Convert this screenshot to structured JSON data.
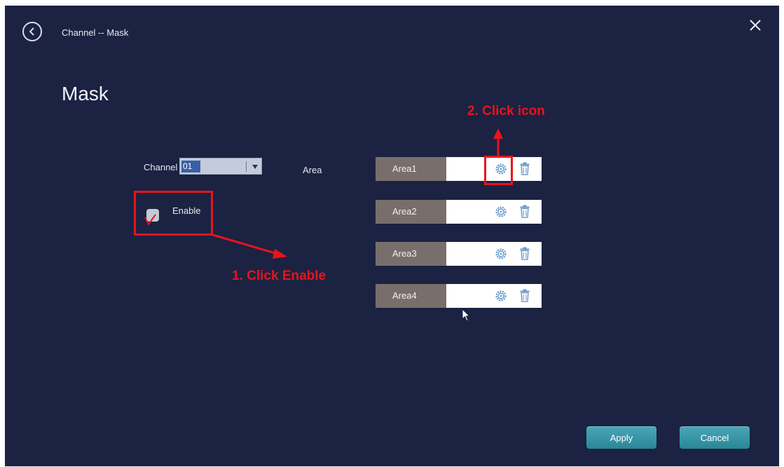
{
  "header": {
    "breadcrumb": "Channel -- Mask",
    "title": "Mask"
  },
  "form": {
    "channel_label": "Channel",
    "channel_value": "01",
    "enable_label": "Enable",
    "enable_checked": true,
    "area_label": "Area"
  },
  "areas": [
    {
      "label": "Area1"
    },
    {
      "label": "Area2"
    },
    {
      "label": "Area3"
    },
    {
      "label": "Area4"
    }
  ],
  "footer": {
    "apply_label": "Apply",
    "cancel_label": "Cancel"
  },
  "annotations": {
    "step1": "1. Click Enable",
    "step2": "2. Click icon",
    "color": "#e8141b"
  },
  "icons": [
    "back-icon",
    "close-icon",
    "gear-icon",
    "trash-icon",
    "chevron-down-icon",
    "checkmark-icon",
    "cursor-icon"
  ]
}
